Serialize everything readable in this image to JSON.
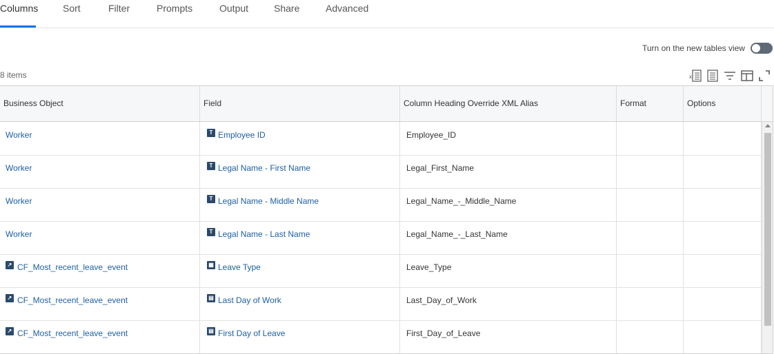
{
  "tabs": [
    {
      "label": "Columns"
    },
    {
      "label": "Sort"
    },
    {
      "label": "Filter"
    },
    {
      "label": "Prompts"
    },
    {
      "label": "Output"
    },
    {
      "label": "Share"
    },
    {
      "label": "Advanced"
    }
  ],
  "active_tab": "Columns",
  "toggle": {
    "label": "Turn on the new tables view",
    "on": false
  },
  "items_count": "8 items",
  "toolbar_icons": [
    "export-excel-icon",
    "export-pdf-icon",
    "filter-icon",
    "column-chooser-icon",
    "fullscreen-icon"
  ],
  "table": {
    "headers": [
      "Business Object",
      "Field",
      "Column Heading Override XML Alias",
      "Format",
      "Options"
    ],
    "rows": [
      {
        "business_object": "Worker",
        "bo_icon": false,
        "field": "Employee ID",
        "field_icon": "T",
        "alias": "Employee_ID"
      },
      {
        "business_object": "Worker",
        "bo_icon": false,
        "field": "Legal Name - First Name",
        "field_icon": "T",
        "alias": "Legal_First_Name"
      },
      {
        "business_object": "Worker",
        "bo_icon": false,
        "field": "Legal Name - Middle Name",
        "field_icon": "T",
        "alias": "Legal_Name_-_Middle_Name"
      },
      {
        "business_object": "Worker",
        "bo_icon": false,
        "field": "Legal Name - Last Name",
        "field_icon": "T",
        "alias": "Legal_Name_-_Last_Name"
      },
      {
        "business_object": "CF_Most_recent_leave_event",
        "bo_icon": true,
        "field": "Leave Type",
        "field_icon": "grid",
        "alias": "Leave_Type"
      },
      {
        "business_object": "CF_Most_recent_leave_event",
        "bo_icon": true,
        "field": "Last Day of Work",
        "field_icon": "cal",
        "alias": "Last_Day_of_Work"
      },
      {
        "business_object": "CF_Most_recent_leave_event",
        "bo_icon": true,
        "field": "First Day of Leave",
        "field_icon": "cal",
        "alias": "First_Day_of_Leave"
      }
    ]
  },
  "colors": {
    "accent": "#0875e1",
    "link": "#1d5fa3",
    "icon_bg": "#2b4a6b"
  }
}
